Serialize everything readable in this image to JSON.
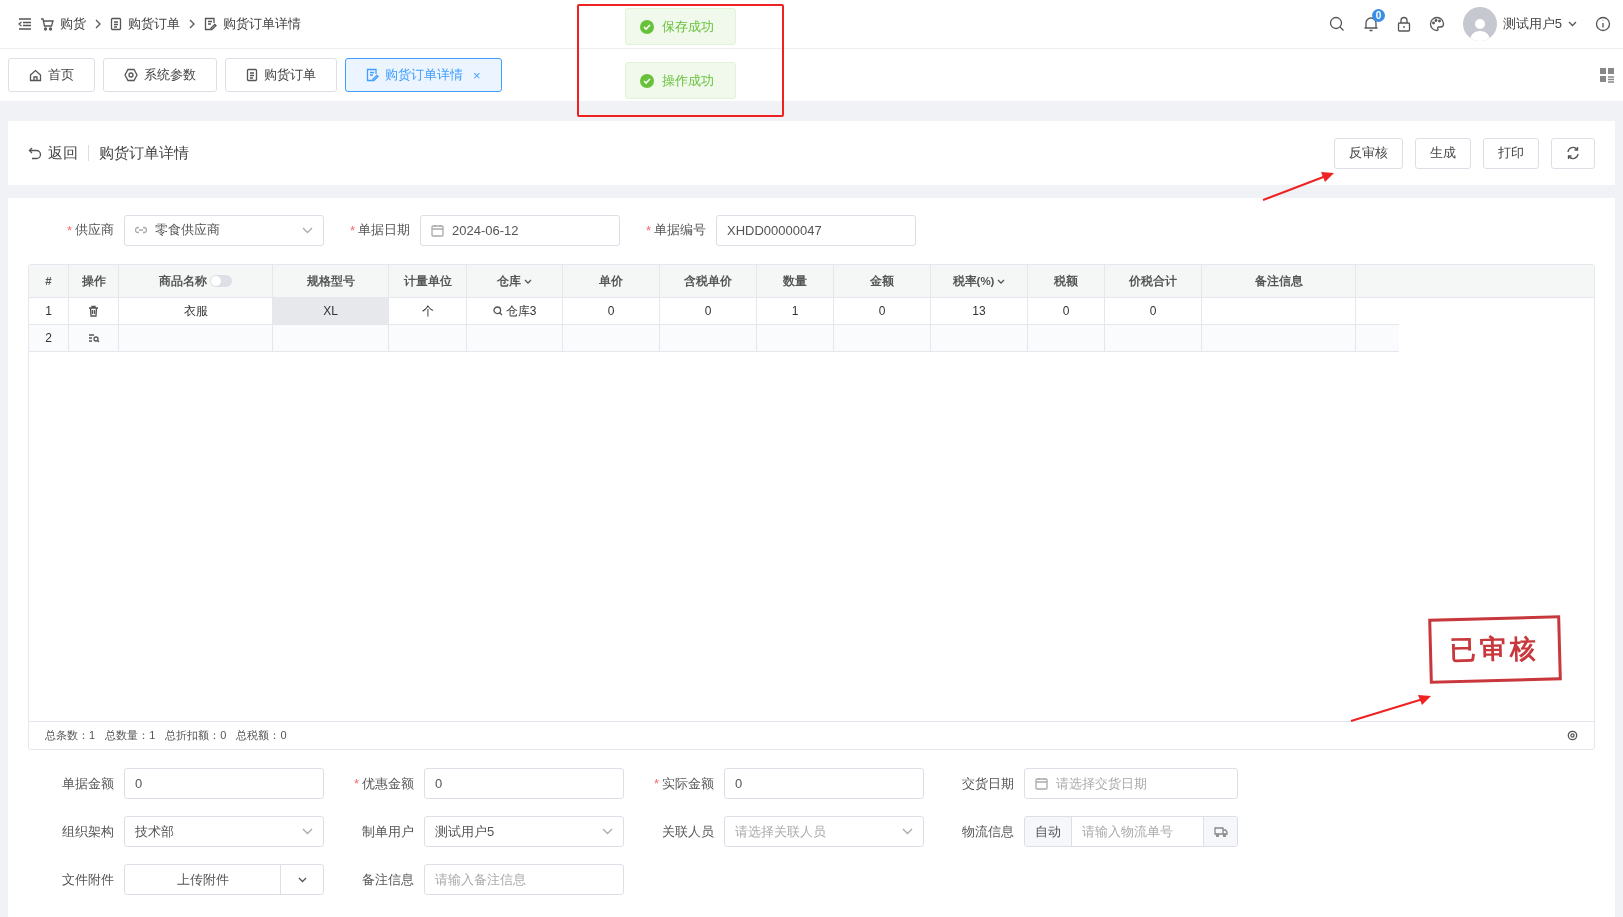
{
  "breadcrumb": [
    "购货",
    "购货订单",
    "购货订单详情"
  ],
  "header": {
    "notification_count": "0",
    "user_name": "测试用户5"
  },
  "tabs": [
    {
      "label": "首页",
      "selected": false
    },
    {
      "label": "系统参数",
      "selected": false
    },
    {
      "label": "购货订单",
      "selected": false
    },
    {
      "label": "购货订单详情",
      "selected": true,
      "close": "×"
    }
  ],
  "toasts": [
    "保存成功",
    "操作成功"
  ],
  "page_header": {
    "back": "返回",
    "title": "购货订单详情",
    "buttons": [
      "反审核",
      "生成",
      "打印"
    ]
  },
  "top_fields": [
    {
      "label": "供应商",
      "required_mark": "*",
      "kind": "select",
      "value": "零食供应商"
    },
    {
      "label": "单据日期",
      "required_mark": "*",
      "kind": "date",
      "value": "2024-06-12"
    },
    {
      "label": "单据编号",
      "required_mark": "*",
      "kind": "text",
      "value": "XHDD00000047"
    }
  ],
  "table": {
    "columns": [
      {
        "label": "#",
        "kind": "plain"
      },
      {
        "label": "操作",
        "kind": "plain"
      },
      {
        "label": "商品名称",
        "kind": "toggle",
        "on": false
      },
      {
        "label": "规格型号",
        "kind": "plain"
      },
      {
        "label": "计量单位",
        "kind": "plain"
      },
      {
        "label": "仓库",
        "kind": "lookup"
      },
      {
        "label": "单价",
        "kind": "plain"
      },
      {
        "label": "含税单价",
        "kind": "plain"
      },
      {
        "label": "数量",
        "kind": "plain"
      },
      {
        "label": "金额",
        "kind": "plain"
      },
      {
        "label": "税率(%)",
        "kind": "sort"
      },
      {
        "label": "税额",
        "kind": "plain"
      },
      {
        "label": "价税合计",
        "kind": "plain"
      },
      {
        "label": "备注信息",
        "kind": "plain"
      }
    ],
    "rows": [
      {
        "kind": "item",
        "cells": [
          {
            "text": "1",
            "active": false
          },
          {
            "active": false
          },
          {
            "text": "衣服",
            "active": false
          },
          {
            "text": "XL",
            "active": true
          },
          {
            "text": "个",
            "active": false
          },
          {
            "text": "仓库3",
            "active": false
          },
          {
            "text": "0",
            "active": false
          },
          {
            "text": "0",
            "active": false
          },
          {
            "text": "1",
            "active": false
          },
          {
            "text": "0",
            "active": false
          },
          {
            "text": "13",
            "active": false
          },
          {
            "text": "0",
            "active": false
          },
          {
            "text": "0",
            "active": false
          },
          {
            "active": false
          }
        ]
      },
      {
        "kind": "new",
        "cells": [
          {
            "text": "2",
            "active": false
          },
          {
            "active": false
          },
          {
            "active": false
          },
          {
            "active": false
          },
          {
            "active": false
          },
          {
            "active": false
          },
          {
            "active": false
          },
          {
            "active": false
          },
          {
            "active": false
          },
          {
            "active": false
          },
          {
            "active": false
          },
          {
            "active": false
          },
          {
            "active": false
          },
          {
            "active": false
          }
        ]
      }
    ],
    "summary": [
      "总条数：1",
      "总数量：1",
      "总折扣额：0",
      "总税额：0"
    ],
    "stamp": "已审核"
  },
  "bottom_fields": [
    {
      "label": "单据金额",
      "kind": "text",
      "value": "0"
    },
    {
      "label": "优惠金额",
      "required_mark": "*",
      "kind": "text",
      "value": "0"
    },
    {
      "label": "实际金额",
      "required_mark": "*",
      "kind": "text",
      "value": "0"
    },
    {
      "label": "交货日期",
      "kind": "date",
      "placeholder": "请选择交货日期"
    },
    {
      "label": "组织架构",
      "kind": "select",
      "value": "技术部"
    },
    {
      "label": "制单用户",
      "kind": "select",
      "value": "测试用户5"
    },
    {
      "label": "关联人员",
      "kind": "select",
      "placeholder": "请选择关联人员"
    },
    {
      "label": "物流信息",
      "kind": "logistics",
      "addon": "自动",
      "placeholder": "请输入物流单号"
    },
    {
      "label": "文件附件",
      "kind": "upload",
      "value": "上传附件"
    },
    {
      "label": "备注信息",
      "kind": "text",
      "placeholder": "请输入备注信息"
    }
  ]
}
